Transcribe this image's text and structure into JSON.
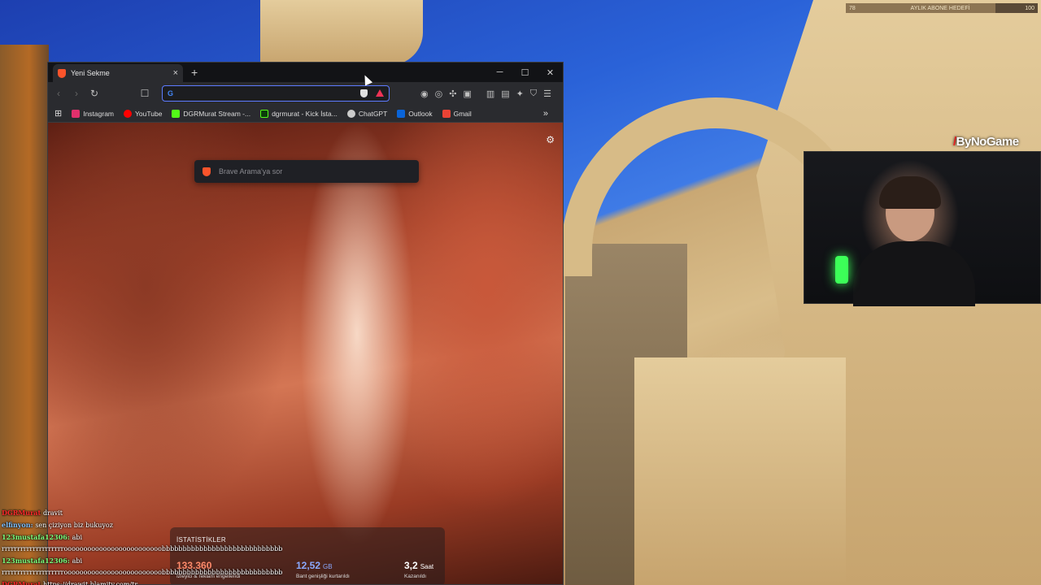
{
  "browser": {
    "tab_title": "Yeni Sekme",
    "tab_close": "×",
    "new_tab": "+",
    "window_controls": {
      "minimize": "─",
      "maximize": "☐",
      "close": "✕"
    },
    "toolbar": {
      "back": "‹",
      "forward": "›",
      "reload": "↻",
      "bookmark": "☐",
      "menu": "☰"
    },
    "address": {
      "value": "",
      "engine_icon": "G"
    },
    "bookmarks": [
      {
        "label": "Instagram",
        "color": "#e1306c"
      },
      {
        "label": "YouTube",
        "color": "#ff0000"
      },
      {
        "label": "DGRMurat Stream -...",
        "color": "#53fc18"
      },
      {
        "label": "dgrmurat - Kick İsta...",
        "color": "#53fc18"
      },
      {
        "label": "ChatGPT",
        "color": "#cccccc"
      },
      {
        "label": "Outlook",
        "color": "#0a64d8"
      },
      {
        "label": "Gmail",
        "color": "#ea4335"
      }
    ],
    "bookmarks_more": "»",
    "newtab": {
      "search_placeholder": "Brave Arama'ya sor",
      "settings_icon": "⚙",
      "stats": {
        "title": "İSTATİSTİKLER",
        "items": [
          {
            "value": "133.360",
            "unit": "",
            "label": "İzleyici & reklam engellendi",
            "color": "#ff8a6a"
          },
          {
            "value": "12,52",
            "unit": "GB",
            "label": "Bant genişliği kurtarıldı",
            "color": "#8aa9ff"
          },
          {
            "value": "3,2",
            "unit": "Saat",
            "label": "Kazanıldı",
            "color": "#ffffff"
          }
        ]
      }
    }
  },
  "overlay": {
    "subgoal": {
      "current": "78",
      "label": "AYLIK ABONE HEDEFİ",
      "target": "100",
      "progress": 0.78
    },
    "logo": {
      "prefix": "/",
      "name": "ByNoGame"
    }
  },
  "chat": [
    {
      "user": "DGRMurat",
      "user_color": "#ff2a2a",
      "text": "dravit"
    },
    {
      "user": "elfinyon:",
      "user_color": "#7fc0ff",
      "text": "sen çiziyon biz bukuyoz"
    },
    {
      "user": "123mustafa12306:",
      "user_color": "#7dff7d",
      "text": "abi"
    },
    {
      "user": "",
      "user_color": "#ffffff",
      "text": "rrrrrrrrrrrrrrrrrrrrooooooooooooooooooooooooobbbbbbbbbbbbbbbbbbbbbbbbbbbbbbllllllllllllllllooooo"
    },
    {
      "user": "123mustafa12306:",
      "user_color": "#7dff7d",
      "text": "abi"
    },
    {
      "user": "",
      "user_color": "#ffffff",
      "text": "rrrrrrrrrrrrrrrrrrrrooooooooooooooooooooooooobbbbbbbbbbbbbbbbbbbbbbbbbbbbbbllllllllllllllllooooo"
    },
    {
      "user": "DGRMurat",
      "user_color": "#ff2a2a",
      "text": "https://drawit.blamity.com/tr"
    }
  ]
}
